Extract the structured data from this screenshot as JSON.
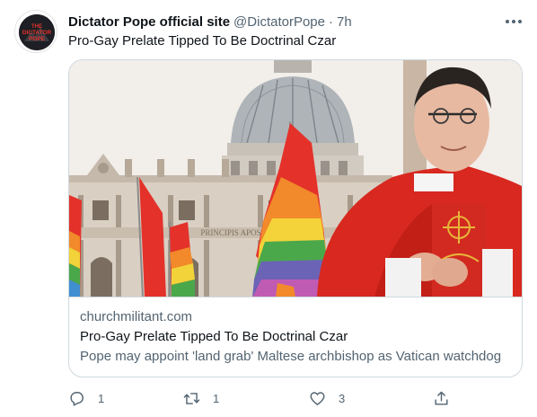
{
  "account": {
    "display_name": "Dictator Pope official site",
    "handle": "@DictatorPope",
    "separator": "·",
    "time": "7h",
    "avatar": {
      "logo_line1": "THE",
      "logo_line2": "DICTATOR",
      "logo_line3": "POPE"
    }
  },
  "tweet": {
    "text": "Pro-Gay Prelate Tipped To Be Doctrinal Czar"
  },
  "card": {
    "domain": "churchmilitant.com",
    "title": "Pro-Gay Prelate Tipped To Be Doctrinal Czar",
    "description": "Pope may appoint 'land grab' Maltese archbishop as Vatican watchdog",
    "image": {
      "inscription": "PRINCIPIS APOS"
    }
  },
  "actions": {
    "reply_count": "1",
    "retweet_count": "1",
    "like_count": "3",
    "icons": [
      "reply-icon",
      "retweet-icon",
      "like-icon",
      "share-icon",
      "more-icon"
    ]
  },
  "colors": {
    "text_primary": "#0f1419",
    "text_secondary": "#536471",
    "border": "#cfd9de",
    "cassock_red": "#d8281f"
  }
}
